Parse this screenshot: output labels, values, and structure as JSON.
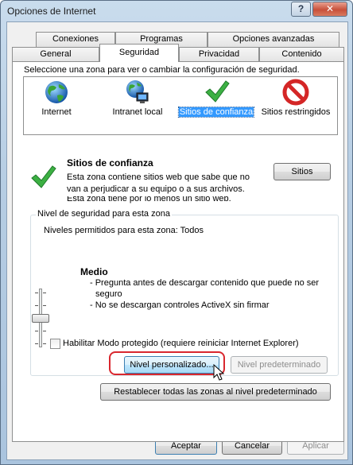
{
  "window": {
    "title": "Opciones de Internet",
    "help_glyph": "?",
    "close_glyph": "✕"
  },
  "tabs": {
    "row_back": [
      "Conexiones",
      "Programas",
      "Opciones avanzadas"
    ],
    "row_front": [
      "General",
      "Seguridad",
      "Privacidad",
      "Contenido"
    ],
    "active": "Seguridad"
  },
  "security": {
    "select_zone_label": "Seleccione una zona para ver o cambiar la configuración de seguridad.",
    "zones": [
      {
        "label": "Internet",
        "icon": "globe-icon"
      },
      {
        "label": "Intranet local",
        "icon": "intranet-icon"
      },
      {
        "label": "Sitios de confianza",
        "icon": "checkmark-icon",
        "selected": true
      },
      {
        "label": "Sitios restringidos",
        "icon": "restricted-icon"
      }
    ],
    "zone_title": "Sitios de confianza",
    "zone_desc": [
      "Esta zona contiene sitios web que sabe que no",
      "van a perjudicar a su equipo o a sus archivos."
    ],
    "zone_desc_partial": "Esta zona tiene por lo menos un sitio web.",
    "sites_button": "Sitios",
    "level_group_label": "Nivel de seguridad para esta zona",
    "allowed_levels": "Niveles permitidos para esta zona: Todos",
    "level_name": "Medio",
    "level_bullets": [
      "- Pregunta antes de descargar contenido que puede no ser",
      "seguro",
      "- No se descargan controles ActiveX sin firmar"
    ],
    "protected_mode": {
      "label": "Habilitar Modo protegido (requiere reiniciar Internet Explorer)",
      "checked": false
    },
    "custom_level_button": "Nivel personalizado...",
    "default_level_button": "Nivel predeterminado",
    "reset_all_button": "Restablecer todas las zonas al nivel predeterminado"
  },
  "footer": {
    "ok": "Aceptar",
    "cancel": "Cancelar",
    "apply": "Aplicar"
  },
  "colors": {
    "selection": "#3399ff",
    "highlight_ring": "#d9272e",
    "trusted_check": "#3cb043",
    "restricted": "#d42626"
  }
}
